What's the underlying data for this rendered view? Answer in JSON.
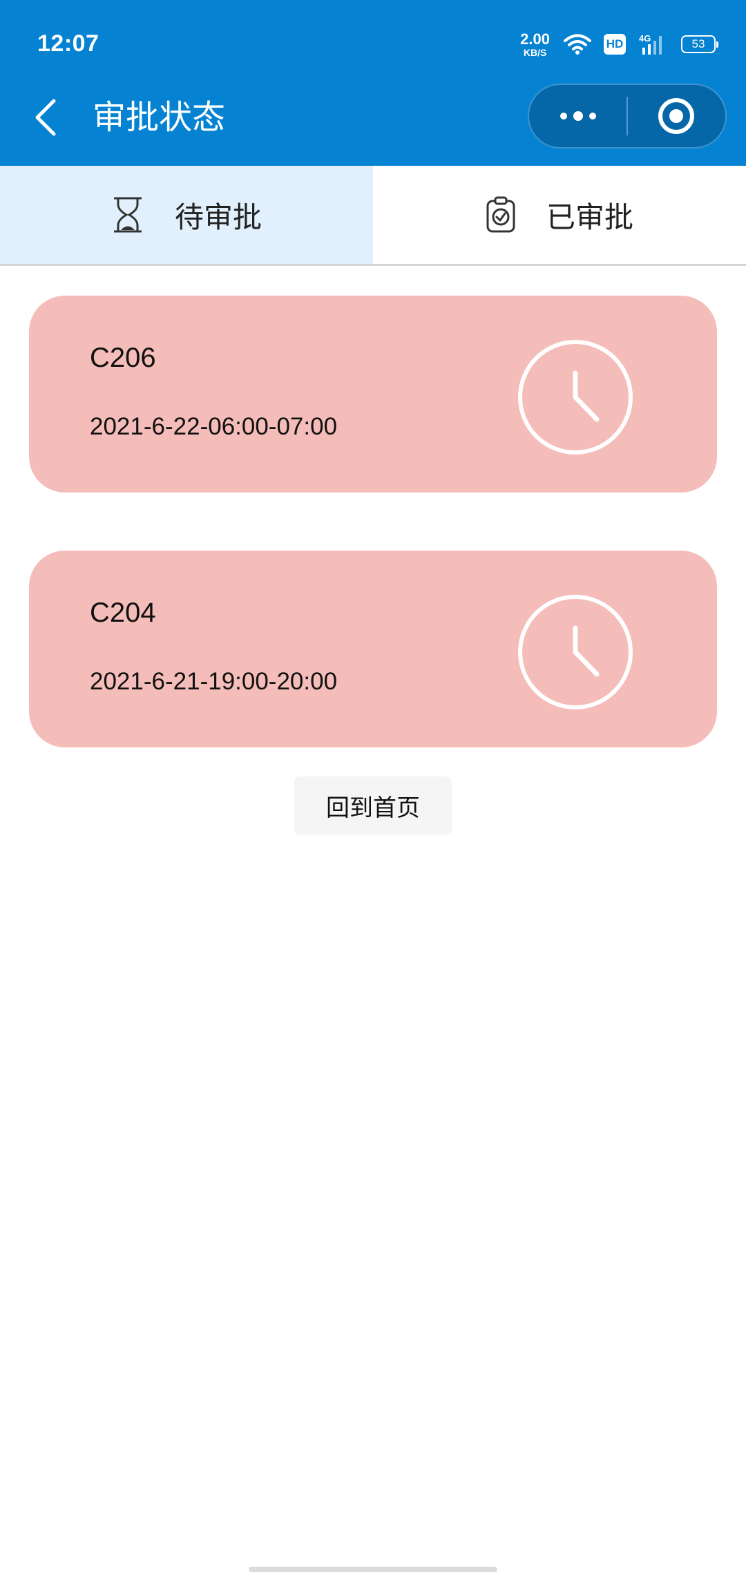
{
  "status_bar": {
    "time": "12:07",
    "net_speed_value": "2.00",
    "net_speed_unit": "KB/S",
    "hd_label": "HD",
    "network_label": "4G",
    "battery_level": "53",
    "icons": [
      "wifi-icon",
      "hd-icon",
      "signal-icon",
      "battery-icon"
    ]
  },
  "nav": {
    "title": "审批状态",
    "back_icon": "chevron-left-icon",
    "more_icon": "more-dots-icon",
    "close_icon": "target-close-icon"
  },
  "tabs": [
    {
      "label": "待审批",
      "icon": "hourglass-icon",
      "active": true
    },
    {
      "label": "已审批",
      "icon": "clipboard-check-icon",
      "active": false
    }
  ],
  "requests": [
    {
      "room": "C206",
      "time": "2021-6-22-06:00-07:00",
      "status_icon": "clock-icon"
    },
    {
      "room": "C204",
      "time": "2021-6-21-19:00-20:00",
      "status_icon": "clock-icon"
    }
  ],
  "home_button": {
    "label": "回到首页"
  },
  "colors": {
    "header_bg": "#0583d2",
    "active_tab_bg": "#e1f0fc",
    "card_bg": "#f5bdb9",
    "home_button_bg": "#f5f5f5"
  }
}
